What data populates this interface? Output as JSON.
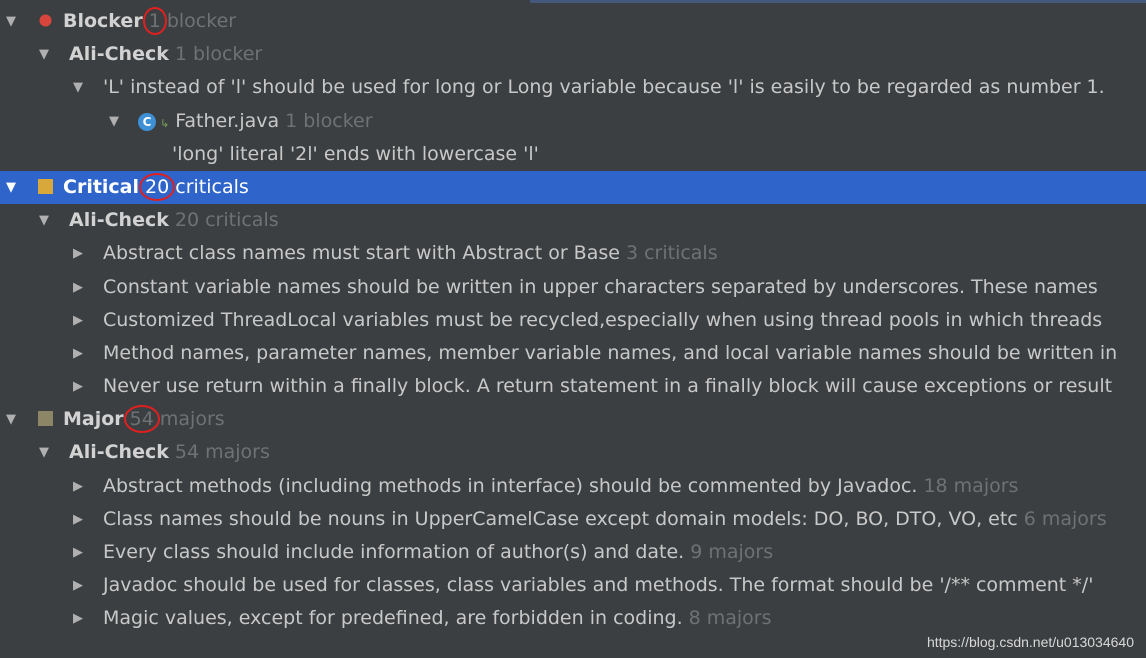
{
  "tree": {
    "blocker": {
      "label": "Blocker",
      "num": "1",
      "unit": "blocker",
      "color": "#d8453c",
      "check": {
        "label": "Ali-Check",
        "count": "1 blocker"
      },
      "rule": "'L' instead of 'l' should be used for long or Long variable because 'l' is easily to be regarded as number 1.",
      "file": {
        "icon": "C",
        "name": "Father.java",
        "count": "1 blocker"
      },
      "problem": "'long' literal '2l' ends with lowercase 'l'"
    },
    "critical": {
      "label": "Critical",
      "num": "20",
      "unit": "criticals",
      "color": "#d9a83a",
      "check": {
        "label": "Ali-Check",
        "count": "20 criticals"
      },
      "rules": [
        {
          "text": "Abstract class names must start with Abstract or Base",
          "count": "3 criticals"
        },
        {
          "text": "Constant variable names should be written in upper characters separated by underscores. These names",
          "count": ""
        },
        {
          "text": "Customized ThreadLocal variables must be recycled,especially when using thread pools in which threads",
          "count": ""
        },
        {
          "text": "Method names, parameter names, member variable names, and local variable names should be written in",
          "count": ""
        },
        {
          "text": "Never use return within a finally block. A return statement in a finally block will cause exceptions or result",
          "count": ""
        }
      ]
    },
    "major": {
      "label": "Major",
      "num": "54",
      "unit": "majors",
      "color": "#8c8566",
      "check": {
        "label": "Ali-Check",
        "count": "54 majors"
      },
      "rules": [
        {
          "text": "Abstract methods (including methods in interface) should be commented by Javadoc.",
          "count": "18 majors"
        },
        {
          "text": "Class names should be nouns in UpperCamelCase except domain models: DO, BO, DTO, VO, etc",
          "count": "6 majors"
        },
        {
          "text": "Every class should include information of author(s) and date.",
          "count": "9 majors"
        },
        {
          "text": "Javadoc should be used for classes, class variables and methods. The format should be '/** comment */'",
          "count": ""
        },
        {
          "text": "Magic values, except for predefined, are forbidden in coding.",
          "count": "8 majors"
        }
      ]
    }
  },
  "icons": {
    "expanded": "▼",
    "collapsed": "▶"
  },
  "watermark": "https://blog.csdn.net/u013034640"
}
